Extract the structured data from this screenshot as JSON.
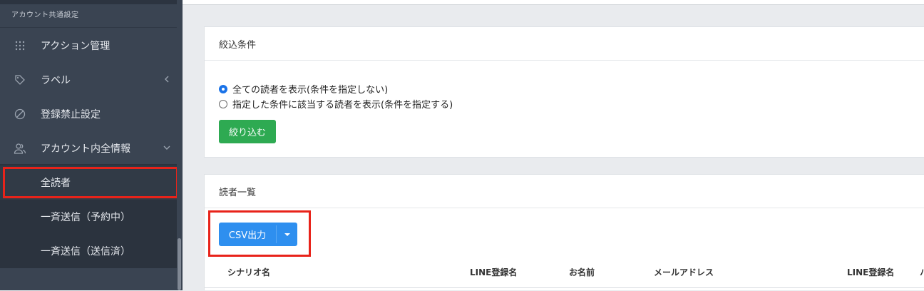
{
  "sidebar": {
    "section_title": "アカウント共通設定",
    "items": [
      {
        "label": "アクション管理",
        "icon": "grid-dots-icon"
      },
      {
        "label": "ラベル",
        "icon": "tag-icon",
        "chevron": "chevron-left-icon"
      },
      {
        "label": "登録禁止設定",
        "icon": "ban-icon"
      },
      {
        "label": "アカウント内全情報",
        "icon": "users-icon",
        "chevron": "chevron-down-icon"
      }
    ],
    "sub_items": [
      {
        "label": "全読者",
        "active": true
      },
      {
        "label": "一斉送信（予約中）"
      },
      {
        "label": "一斉送信（送信済）"
      }
    ]
  },
  "filter_card": {
    "title": "絞込条件",
    "options": [
      {
        "label": "全ての読者を表示(条件を指定しない)",
        "checked": true
      },
      {
        "label": "指定した条件に該当する読者を表示(条件を指定する)",
        "checked": false
      }
    ],
    "submit_label": "絞り込む"
  },
  "readers_card": {
    "title": "読者一覧",
    "csv_button_label": "CSV出力",
    "columns": [
      "シナリオ名",
      "LINE登録名",
      "お名前",
      "メールアドレス",
      "LINE登録名",
      "ハ"
    ]
  },
  "colors": {
    "sidebar_bg": "#3a4452",
    "highlight": "#e8231a",
    "green_button": "#2eaa52",
    "blue_button": "#2e8fef"
  }
}
